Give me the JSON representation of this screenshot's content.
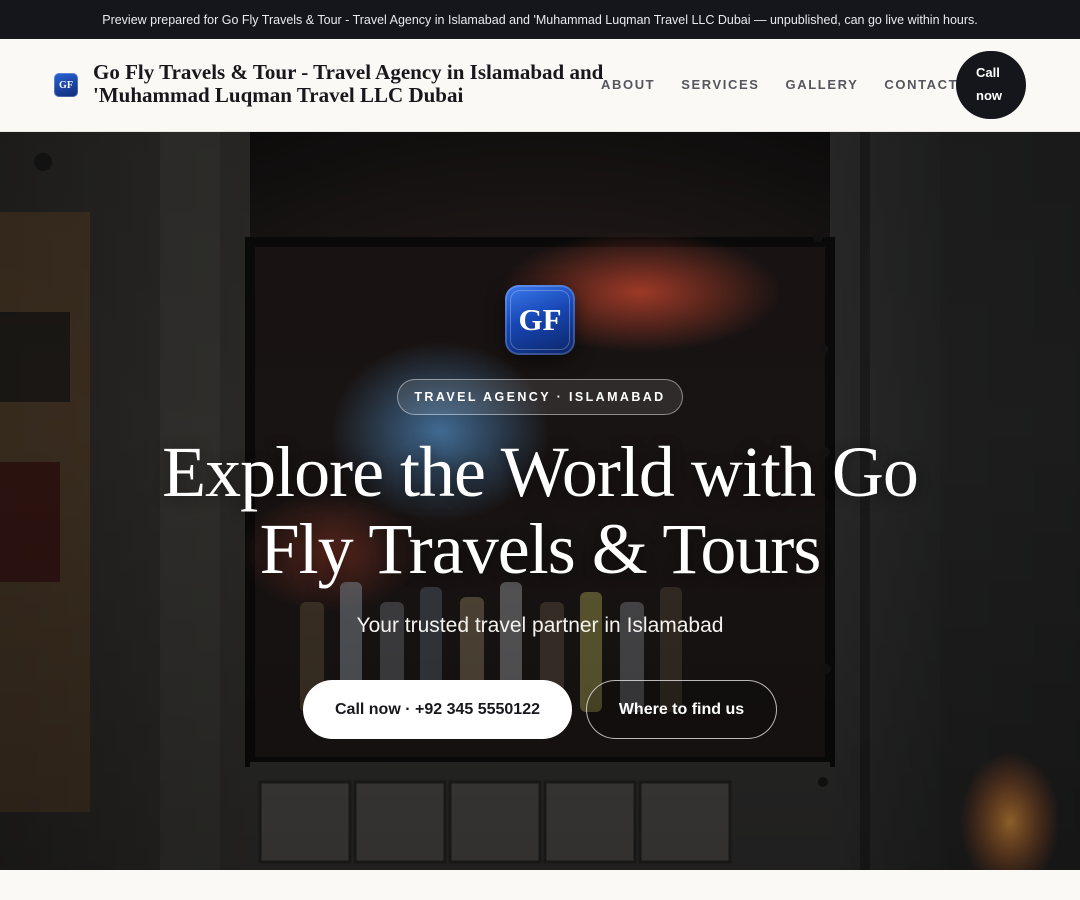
{
  "preview_banner": {
    "text": "Preview prepared for Go Fly Travels & Tour - Travel Agency in Islamabad and 'Muhammad Luqman Travel LLC Dubai — unpublished, can go live within hours."
  },
  "header": {
    "logo_text": "GF",
    "brand_name": "Go Fly Travels & Tour - Travel Agency in Islamabad and 'Muhammad Luqman Travel LLC Dubai",
    "nav": [
      {
        "label": "ABOUT"
      },
      {
        "label": "SERVICES"
      },
      {
        "label": "GALLERY"
      },
      {
        "label": "CONTACT"
      }
    ],
    "call_button": "Call now"
  },
  "hero": {
    "logo_text": "GF",
    "badge": "TRAVEL AGENCY · ISLAMABAD",
    "title": "Explore the World with Go Fly Travels & Tours",
    "subtitle": "Your trusted travel partner in Islamabad",
    "primary_cta": "Call now · +92 345 5550122",
    "secondary_cta": "Where to find us",
    "background_image": "night-street-shop-window-photo"
  },
  "colors": {
    "topbar_bg": "#15161b",
    "page_bg": "#faf9f6",
    "logo_blue": "#1747b4",
    "button_dark": "#15161b"
  }
}
